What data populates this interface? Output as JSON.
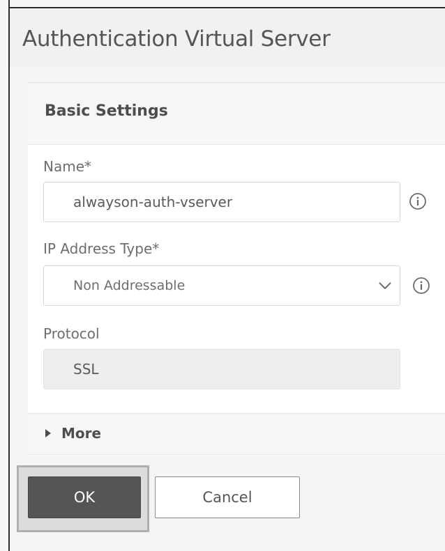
{
  "dialog": {
    "title": "Authentication Virtual Server"
  },
  "basic_settings": {
    "title": "Basic Settings",
    "name": {
      "label": "Name*",
      "value": "alwayson-auth-vserver",
      "info_icon": "info-icon"
    },
    "ip_address_type": {
      "label": "IP Address Type*",
      "selected": "Non Addressable",
      "dropdown_icon": "chevron-down-icon",
      "info_icon": "info-icon"
    },
    "protocol": {
      "label": "Protocol",
      "value": "SSL"
    },
    "more": {
      "label": "More",
      "icon": "caret-right-icon"
    }
  },
  "actions": {
    "ok_label": "OK",
    "cancel_label": "Cancel"
  },
  "colors": {
    "ok_button_bg": "#555555",
    "ok_highlight_border": "#b0b0b0",
    "header_bg": "#f1f1f1",
    "panel_bg": "#ffffff"
  }
}
